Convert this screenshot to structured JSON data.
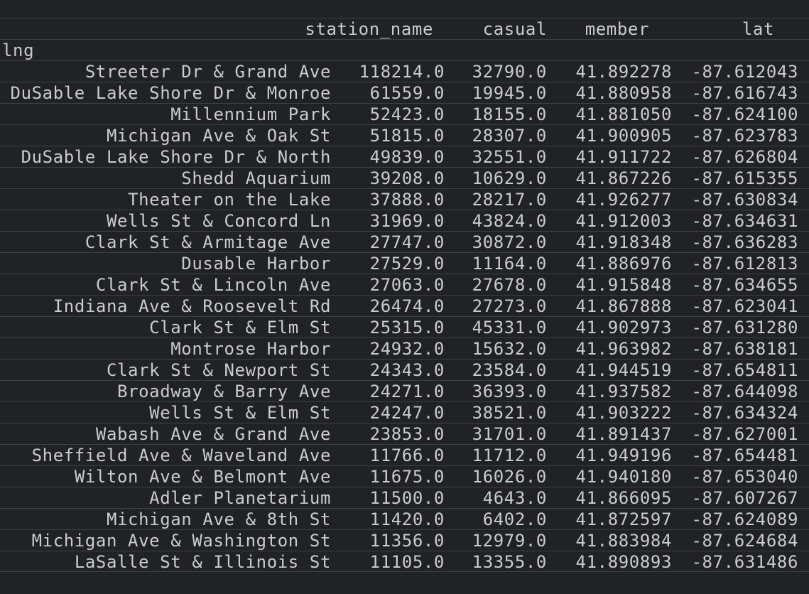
{
  "columns": {
    "station_name": "station_name",
    "casual": "casual",
    "member": "member",
    "lat": "lat"
  },
  "index_name": "lng",
  "rows": [
    {
      "station_name": "Streeter Dr & Grand Ave",
      "casual": "118214.0",
      "member": "32790.0",
      "lat": "41.892278",
      "lng": "-87.612043"
    },
    {
      "station_name": "DuSable Lake Shore Dr & Monroe",
      "casual": "61559.0",
      "member": "19945.0",
      "lat": "41.880958",
      "lng": "-87.616743"
    },
    {
      "station_name": "Millennium Park",
      "casual": "52423.0",
      "member": "18155.0",
      "lat": "41.881050",
      "lng": "-87.624100"
    },
    {
      "station_name": "Michigan Ave & Oak St",
      "casual": "51815.0",
      "member": "28307.0",
      "lat": "41.900905",
      "lng": "-87.623783"
    },
    {
      "station_name": "DuSable Lake Shore Dr & North",
      "casual": "49839.0",
      "member": "32551.0",
      "lat": "41.911722",
      "lng": "-87.626804"
    },
    {
      "station_name": "Shedd Aquarium",
      "casual": "39208.0",
      "member": "10629.0",
      "lat": "41.867226",
      "lng": "-87.615355"
    },
    {
      "station_name": "Theater on the Lake",
      "casual": "37888.0",
      "member": "28217.0",
      "lat": "41.926277",
      "lng": "-87.630834"
    },
    {
      "station_name": "Wells St & Concord Ln",
      "casual": "31969.0",
      "member": "43824.0",
      "lat": "41.912003",
      "lng": "-87.634631"
    },
    {
      "station_name": "Clark St & Armitage Ave",
      "casual": "27747.0",
      "member": "30872.0",
      "lat": "41.918348",
      "lng": "-87.636283"
    },
    {
      "station_name": "Dusable Harbor",
      "casual": "27529.0",
      "member": "11164.0",
      "lat": "41.886976",
      "lng": "-87.612813"
    },
    {
      "station_name": "Clark St & Lincoln Ave",
      "casual": "27063.0",
      "member": "27678.0",
      "lat": "41.915848",
      "lng": "-87.634655"
    },
    {
      "station_name": "Indiana Ave & Roosevelt Rd",
      "casual": "26474.0",
      "member": "27273.0",
      "lat": "41.867888",
      "lng": "-87.623041"
    },
    {
      "station_name": "Clark St & Elm St",
      "casual": "25315.0",
      "member": "45331.0",
      "lat": "41.902973",
      "lng": "-87.631280"
    },
    {
      "station_name": "Montrose Harbor",
      "casual": "24932.0",
      "member": "15632.0",
      "lat": "41.963982",
      "lng": "-87.638181"
    },
    {
      "station_name": "Clark St & Newport St",
      "casual": "24343.0",
      "member": "23584.0",
      "lat": "41.944519",
      "lng": "-87.654811"
    },
    {
      "station_name": "Broadway & Barry Ave",
      "casual": "24271.0",
      "member": "36393.0",
      "lat": "41.937582",
      "lng": "-87.644098"
    },
    {
      "station_name": "Wells St & Elm St",
      "casual": "24247.0",
      "member": "38521.0",
      "lat": "41.903222",
      "lng": "-87.634324"
    },
    {
      "station_name": "Wabash Ave & Grand Ave",
      "casual": "23853.0",
      "member": "31701.0",
      "lat": "41.891437",
      "lng": "-87.627001"
    },
    {
      "station_name": "Sheffield Ave & Waveland Ave",
      "casual": "11766.0",
      "member": "11712.0",
      "lat": "41.949196",
      "lng": "-87.654481"
    },
    {
      "station_name": "Wilton Ave & Belmont Ave",
      "casual": "11675.0",
      "member": "16026.0",
      "lat": "41.940180",
      "lng": "-87.653040"
    },
    {
      "station_name": "Adler Planetarium",
      "casual": "11500.0",
      "member": "4643.0",
      "lat": "41.866095",
      "lng": "-87.607267"
    },
    {
      "station_name": "Michigan Ave & 8th St",
      "casual": "11420.0",
      "member": "6402.0",
      "lat": "41.872597",
      "lng": "-87.624089"
    },
    {
      "station_name": "Michigan Ave & Washington St",
      "casual": "11356.0",
      "member": "12979.0",
      "lat": "41.883984",
      "lng": "-87.624684"
    },
    {
      "station_name": "LaSalle St & Illinois St",
      "casual": "11105.0",
      "member": "13355.0",
      "lat": "41.890893",
      "lng": "-87.631486"
    }
  ]
}
